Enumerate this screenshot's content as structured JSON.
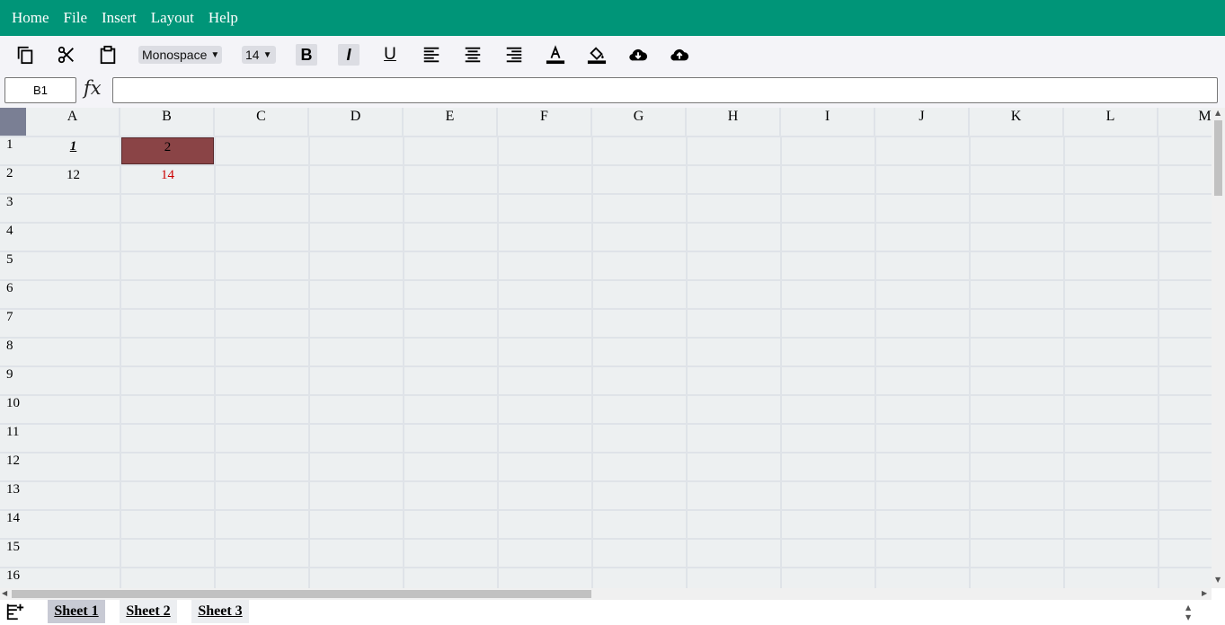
{
  "menu": [
    "Home",
    "File",
    "Insert",
    "Layout",
    "Help"
  ],
  "toolbar": {
    "icons": [
      "copy-icon",
      "cut-icon",
      "paste-icon"
    ],
    "font_family": "Monospace",
    "font_size": "14",
    "bold_label": "B",
    "italic_label": "I",
    "underline_label": "U"
  },
  "formula": {
    "cell_ref": "B1",
    "fx_label": "fx",
    "value": ""
  },
  "columns": [
    "A",
    "B",
    "C",
    "D",
    "E",
    "F",
    "G",
    "H",
    "I",
    "J",
    "K",
    "L",
    "M"
  ],
  "rows": [
    "1",
    "2",
    "3",
    "4",
    "5",
    "6",
    "7",
    "8",
    "9",
    "10",
    "11",
    "12",
    "13",
    "14",
    "15",
    "16"
  ],
  "cells": {
    "A1": "1",
    "B1": "2",
    "A2": "12",
    "B2": "14"
  },
  "colors": {
    "header_green": "#009578",
    "selected_cell_fill": "#8a4446",
    "red_text": "#cc0000"
  },
  "sheets": [
    "Sheet 1",
    "Sheet 2",
    "Sheet 3"
  ]
}
